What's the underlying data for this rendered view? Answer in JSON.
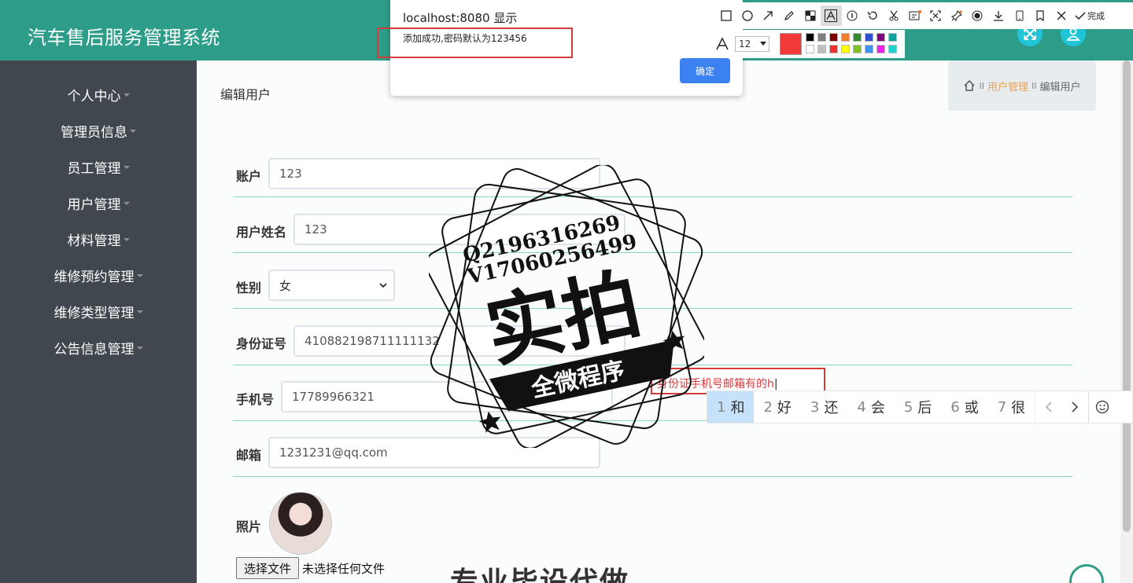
{
  "header": {
    "title": "汽车售后服务管理系统"
  },
  "sidebar": {
    "items": [
      {
        "label": "个人中心"
      },
      {
        "label": "管理员信息"
      },
      {
        "label": "员工管理"
      },
      {
        "label": "用户管理"
      },
      {
        "label": "材料管理"
      },
      {
        "label": "维修预约管理"
      },
      {
        "label": "维修类型管理"
      },
      {
        "label": "公告信息管理"
      }
    ]
  },
  "main": {
    "page_title": "编辑用户",
    "breadcrumb": {
      "sep": "II",
      "section": "用户管理",
      "current": "编辑用户"
    },
    "form": {
      "account": {
        "label": "账户",
        "value": "123"
      },
      "name": {
        "label": "用户姓名",
        "value": "123"
      },
      "gender": {
        "label": "性别",
        "value": "女"
      },
      "id_card": {
        "label": "身份证号",
        "value": "410882198711111132"
      },
      "phone": {
        "label": "手机号",
        "value": "17789966321"
      },
      "email": {
        "label": "邮箱",
        "value": "1231231@qq.com"
      },
      "photo": {
        "label": "照片",
        "file_button": "选择文件",
        "file_status": "未选择任何文件"
      }
    }
  },
  "dialog": {
    "title": "localhost:8080 显示",
    "message": "添加成功,密码默认为123456",
    "ok_label": "确定"
  },
  "annotation": {
    "done_label": "完成",
    "font_size": "12",
    "current_color": "#f23a3a",
    "text_value": "身份证手机号邮箱有的h",
    "palette": [
      "#000000",
      "#808080",
      "#800000",
      "#f08030",
      "#2e8b2e",
      "#3050d0",
      "#800080",
      "#10a0a0",
      "#ffffff",
      "#c0c0c0",
      "#f03030",
      "#ffff00",
      "#80c020",
      "#4090f0",
      "#f020f0",
      "#20d0d0"
    ]
  },
  "ime": {
    "candidates": [
      {
        "n": "1",
        "w": "和"
      },
      {
        "n": "2",
        "w": "好"
      },
      {
        "n": "3",
        "w": "还"
      },
      {
        "n": "4",
        "w": "会"
      },
      {
        "n": "5",
        "w": "后"
      },
      {
        "n": "6",
        "w": "或"
      },
      {
        "n": "7",
        "w": "很"
      }
    ]
  },
  "watermark": {
    "line1": "Q2196316269",
    "line2": "V17060256499",
    "big": "实拍",
    "ribbon": "全微程序",
    "bottom": "专业毕设代做"
  },
  "colors": {
    "header": "#2d9c89",
    "sidebar": "#40474e",
    "accent": "#e8a35a",
    "primary_button": "#3b82f0"
  }
}
